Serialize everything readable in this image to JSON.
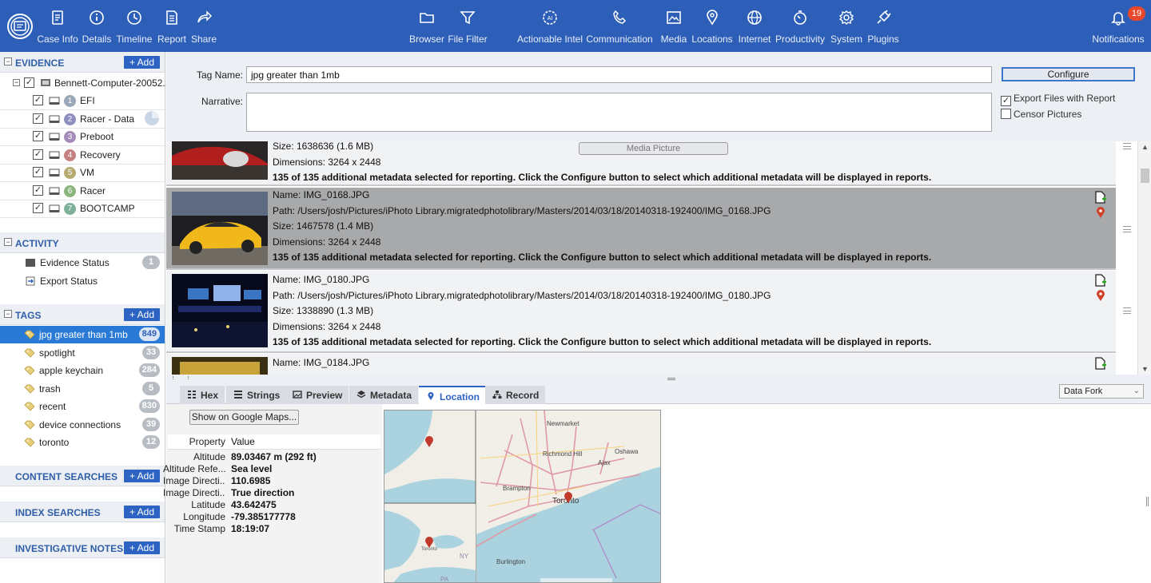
{
  "toolbar": {
    "left": [
      {
        "label": "Case Info",
        "icon": "case-info-icon"
      },
      {
        "label": "Details",
        "icon": "info-icon"
      },
      {
        "label": "Timeline",
        "icon": "clock-icon"
      },
      {
        "label": "Report",
        "icon": "report-icon"
      },
      {
        "label": "Share",
        "icon": "share-icon"
      }
    ],
    "center": [
      {
        "label": "Browser",
        "icon": "folder-icon"
      },
      {
        "label": "File Filter",
        "icon": "filter-icon"
      },
      {
        "label": "Actionable Intel",
        "icon": "actionable-intel-icon"
      },
      {
        "label": "Communication",
        "icon": "phone-icon"
      },
      {
        "label": "Media",
        "icon": "media-icon"
      },
      {
        "label": "Locations",
        "icon": "location-pin-icon"
      },
      {
        "label": "Internet",
        "icon": "globe-icon"
      },
      {
        "label": "Productivity",
        "icon": "productivity-icon"
      },
      {
        "label": "System",
        "icon": "gear-icon"
      },
      {
        "label": "Plugins",
        "icon": "plug-icon"
      }
    ],
    "notifications": {
      "label": "Notifications",
      "count": "19"
    }
  },
  "sidebar": {
    "evidence": {
      "title": "EVIDENCE",
      "add_label": "+ Add",
      "root": "Bennett-Computer-20052...",
      "partitions": [
        {
          "num": "1",
          "label": "EFI",
          "color": "#9aa7b8"
        },
        {
          "num": "2",
          "label": "Racer - Data",
          "color": "#8f8fbf"
        },
        {
          "num": "3",
          "label": "Preboot",
          "color": "#a58bb8"
        },
        {
          "num": "4",
          "label": "Recovery",
          "color": "#c48080"
        },
        {
          "num": "5",
          "label": "VM",
          "color": "#b5a96e"
        },
        {
          "num": "6",
          "label": "Racer",
          "color": "#8db57e"
        },
        {
          "num": "7",
          "label": "BOOTCAMP",
          "color": "#7fb09a"
        }
      ]
    },
    "activity": {
      "title": "ACTIVITY",
      "items": [
        {
          "label": "Evidence Status",
          "count": "1"
        },
        {
          "label": "Export Status",
          "count": ""
        }
      ]
    },
    "tags": {
      "title": "TAGS",
      "add_label": "+ Add",
      "items": [
        {
          "label": "jpg greater than 1mb",
          "count": "849"
        },
        {
          "label": "spotlight",
          "count": "33"
        },
        {
          "label": "apple keychain",
          "count": "284"
        },
        {
          "label": "trash",
          "count": "5"
        },
        {
          "label": "recent",
          "count": "830"
        },
        {
          "label": "device connections",
          "count": "39"
        },
        {
          "label": "toronto",
          "count": "12"
        }
      ]
    },
    "content_searches": {
      "title": "CONTENT SEARCHES",
      "add_label": "+ Add"
    },
    "index_searches": {
      "title": "INDEX SEARCHES",
      "add_label": "+ Add"
    },
    "investigative_notes": {
      "title": "INVESTIGATIVE NOTES",
      "add_label": "+ Add"
    }
  },
  "tag_editor": {
    "name_label": "Tag Name:",
    "name_value": "jpg greater than 1mb",
    "narrative_label": "Narrative:",
    "narrative_value": "",
    "configure_label": "Configure",
    "export_files_label": "Export Files with Report",
    "export_files_checked": true,
    "censor_label": "Censor Pictures",
    "censor_checked": false
  },
  "results": {
    "media_picture_label": "Media Picture",
    "records": [
      {
        "size": "Size: 1638636 (1.6 MB)",
        "dimensions": "Dimensions: 3264 x 2448",
        "note": "135 of 135 additional metadata selected for reporting. Click the Configure button to select which additional metadata will be displayed in reports."
      },
      {
        "name": "Name: IMG_0168.JPG",
        "path": "Path: /Users/josh/Pictures/iPhoto Library.migratedphotolibrary/Masters/2014/03/18/20140318-192400/IMG_0168.JPG",
        "size": "Size: 1467578 (1.4 MB)",
        "dimensions": "Dimensions: 3264 x 2448",
        "note": "135 of 135 additional metadata selected for reporting. Click the Configure button to select which additional metadata will be displayed in reports."
      },
      {
        "name": "Name: IMG_0180.JPG",
        "path": "Path: /Users/josh/Pictures/iPhoto Library.migratedphotolibrary/Masters/2014/03/18/20140318-192400/IMG_0180.JPG",
        "size": "Size: 1338890 (1.3 MB)",
        "dimensions": "Dimensions: 3264 x 2448",
        "note": "135 of 135 additional metadata selected for reporting. Click the Configure button to select which additional metadata will be displayed in reports."
      },
      {
        "name": "Name: IMG_0184.JPG"
      }
    ]
  },
  "tabs": [
    {
      "label": "Hex",
      "active": false
    },
    {
      "label": "Strings",
      "active": false
    },
    {
      "label": "Preview",
      "active": false
    },
    {
      "label": "Metadata",
      "active": false
    },
    {
      "label": "Location",
      "active": true
    },
    {
      "label": "Record",
      "active": false
    }
  ],
  "fork_select": {
    "value": "Data Fork"
  },
  "location": {
    "google_maps_label": "Show on Google Maps...",
    "header_property": "Property",
    "header_value": "Value",
    "properties": [
      {
        "key": "Altitude",
        "value": "89.03467 m (292 ft)"
      },
      {
        "key": "Altitude Refe...",
        "value": "Sea level"
      },
      {
        "key": "Image Directi...",
        "value": "110.6985"
      },
      {
        "key": "Image Directi...",
        "value": "True direction"
      },
      {
        "key": "Latitude",
        "value": "43.642475"
      },
      {
        "key": "Longitude",
        "value": "-79.385177778"
      },
      {
        "key": "Time Stamp",
        "value": "18:19:07"
      }
    ],
    "map_labels": {
      "newmarket": "Newmarket",
      "richmond_hill": "Richmond Hill",
      "oshawa": "Oshawa",
      "ajax": "Ajax",
      "brampton": "Brampton",
      "toronto": "Toronto",
      "burlington": "Burlington",
      "ny": "NY",
      "pa": "PA",
      "toronto_small": "Toronto"
    }
  }
}
